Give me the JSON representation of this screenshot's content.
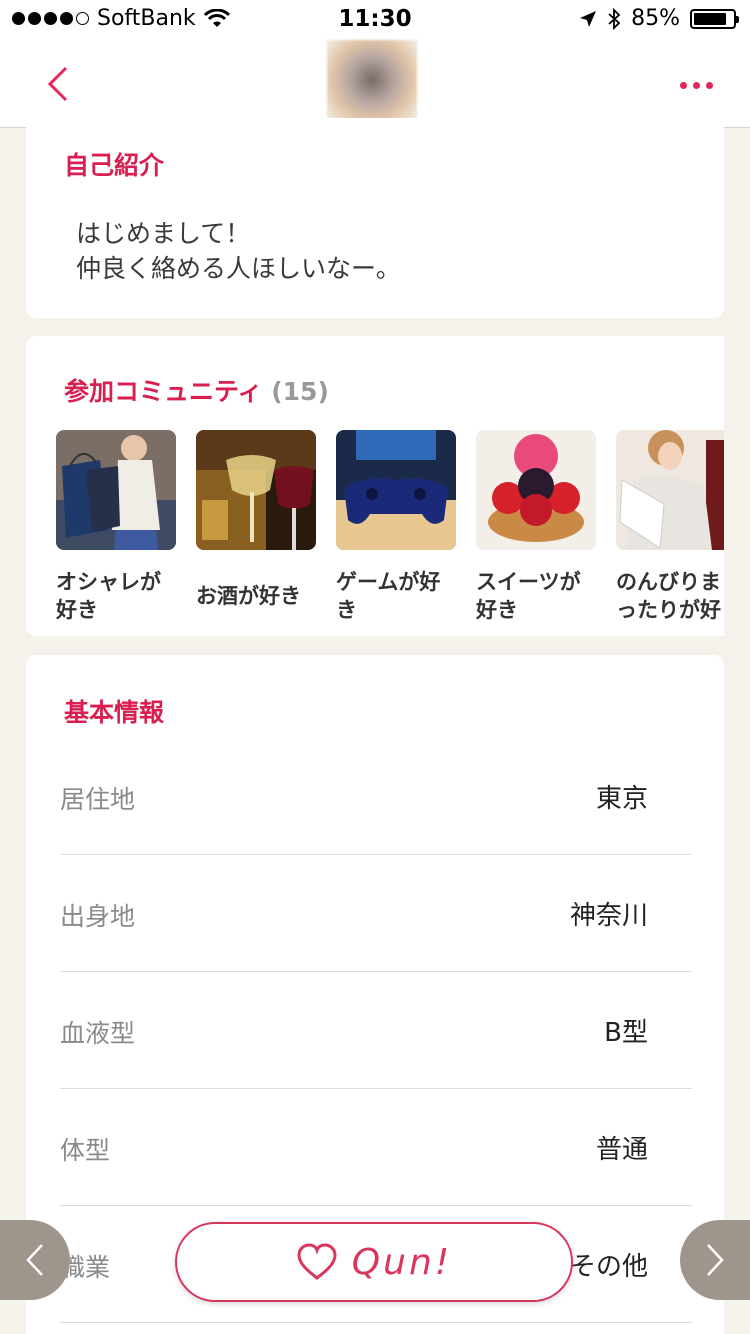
{
  "status_bar": {
    "carrier": "SoftBank",
    "time": "11:30",
    "battery": "85%",
    "battery_level": 0.85,
    "icons": [
      "signal-dots",
      "wifi-icon",
      "location-arrow-icon",
      "bluetooth-icon",
      "battery-icon"
    ]
  },
  "nav": {
    "back_icon": "chevron-left-icon",
    "more_icon": "more-dots-icon"
  },
  "intro": {
    "title": "自己紹介",
    "line1": "はじめまして！",
    "line2": "仲良く絡める人ほしいなー。"
  },
  "communities": {
    "title": "参加コミュニティ",
    "count": "(15)",
    "items": [
      {
        "line1": "オシャレが",
        "line2": "好き",
        "thumb": "shopping-woman"
      },
      {
        "line1": "お酒が好き",
        "line2": "",
        "thumb": "wine-glasses"
      },
      {
        "line1": "ゲームが好",
        "line2": "き",
        "thumb": "game-controller"
      },
      {
        "line1": "スイーツが",
        "line2": "好き",
        "thumb": "berry-tart"
      },
      {
        "line1": "のんびりま",
        "line2": "ったりが好",
        "thumb": "reading-woman"
      }
    ]
  },
  "basic_info": {
    "title": "基本情報",
    "rows": [
      {
        "label": "居住地",
        "value": "東京"
      },
      {
        "label": "出身地",
        "value": "神奈川"
      },
      {
        "label": "血液型",
        "value": "B型"
      },
      {
        "label": "体型",
        "value": "普通"
      },
      {
        "label": "職業",
        "value": "その他"
      }
    ]
  },
  "actions": {
    "qun_label": "Qun!",
    "prev_icon": "chevron-left-icon",
    "next_icon": "chevron-right-icon"
  },
  "colors": {
    "accent": "#d81f50",
    "background": "#f5f2ec",
    "nav_bubble": "#9e958d"
  }
}
